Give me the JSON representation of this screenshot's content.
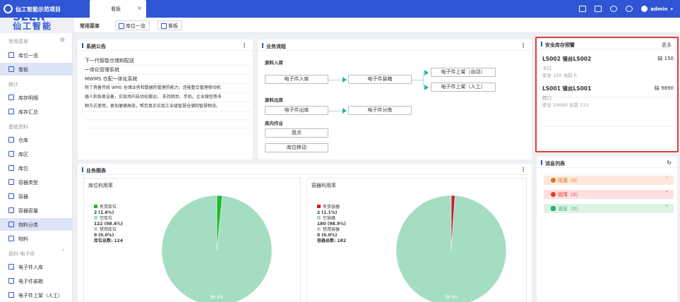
{
  "app": {
    "title": "仙工智能示范项目",
    "brand_text": "SEER",
    "brand_sub": "仙工智能"
  },
  "tabs": [
    {
      "label": "看板"
    }
  ],
  "user": {
    "name": "admin"
  },
  "quickbar": {
    "label": "常用菜单",
    "buttons": [
      {
        "label": "库位一览"
      },
      {
        "label": "看板"
      }
    ]
  },
  "sidebar": {
    "groups": [
      {
        "label": "常用菜单"
      },
      {
        "label": "统计"
      },
      {
        "label": "基础资料"
      },
      {
        "label": "原料-电子件"
      }
    ],
    "items": [
      {
        "label": "库位一览"
      },
      {
        "label": "看板"
      },
      {
        "label": "库存明细"
      },
      {
        "label": "库存汇总"
      },
      {
        "label": "仓库"
      },
      {
        "label": "库区"
      },
      {
        "label": "库位"
      },
      {
        "label": "容器类型"
      },
      {
        "label": "容器"
      },
      {
        "label": "容器容量"
      },
      {
        "label": "物料分类"
      },
      {
        "label": "物料"
      },
      {
        "label": "电子件入库"
      },
      {
        "label": "电子件装箱"
      },
      {
        "label": "电子件上架（人工）"
      }
    ]
  },
  "notice": {
    "title": "系统公告",
    "lines": [
      "下一代智能仓储和配送",
      "一体化管理系统",
      "MWMS 仓配一体化系统",
      "除了具备传统 WMS 仓储业务和数据的管理的能力，还能整合管理移动机",
      "器人和各类设备，实现场内自动化搬运。 支持网页、手机。企业微信等多",
      "种方式使用，更加便捷高效，帮您真正实现工业级智慧仓储和智慧物流。"
    ]
  },
  "flow": {
    "title": "业务流程",
    "sections": [
      {
        "label": "原料入库"
      },
      {
        "label": "原料出库"
      },
      {
        "label": "库内作业"
      }
    ],
    "boxes": [
      {
        "label": "电子件入库"
      },
      {
        "label": "电子件装箱"
      },
      {
        "label": "电子件上架（自动）"
      },
      {
        "label": "电子件上架（人工）"
      },
      {
        "label": "电子件出库"
      },
      {
        "label": "电子件分拣"
      },
      {
        "label": "盘点"
      },
      {
        "label": "库位移动"
      }
    ]
  },
  "safety": {
    "title": "安全库存预警",
    "more": "更多",
    "cards": [
      {
        "code": "LS002  镍丝LS002",
        "qty": "缺 150",
        "type": "卡口",
        "stat": "安全 150   当前 0"
      },
      {
        "code": "LS001  镍丝LS001",
        "qty": "缺 9890",
        "type": "銲口",
        "stat": "安全 10000   当前 110"
      }
    ]
  },
  "messages": {
    "title": "消息列表",
    "rows": [
      {
        "label": "阻塞（0）",
        "color": "#e8711f",
        "bg": "#fde9dc"
      },
      {
        "label": "故障（0）",
        "color": "#e53935",
        "bg": "#fde0df"
      },
      {
        "label": "消息（0）",
        "color": "#2fae6e",
        "bg": "#dcf3e6"
      }
    ]
  },
  "charts_panel": {
    "title": "业务图表"
  },
  "chart_data": [
    {
      "type": "pie",
      "title": "库位利用率",
      "legend": [
        {
          "label": "有货库位",
          "value": "2 (1.6%)",
          "color": "#20b830"
        },
        {
          "label": "空库位",
          "value": "122 (98.4%)",
          "color": "#a5ddc3"
        },
        {
          "label": "禁用库位",
          "value": "0 (0.0%)",
          "color": "#cccccc"
        }
      ],
      "values": [
        2,
        122,
        0
      ],
      "total_label": "库位总数: 124",
      "slice_label": "98.4%"
    },
    {
      "type": "pie",
      "title": "容器利用率",
      "legend": [
        {
          "label": "有货容器",
          "value": "2 (1.1%)",
          "color": "#c8202c"
        },
        {
          "label": "空容器",
          "value": "180 (98.9%)",
          "color": "#a5ddc3"
        },
        {
          "label": "禁用容器",
          "value": "0 (0.0%)",
          "color": "#cccccc"
        }
      ],
      "values": [
        2,
        180,
        0
      ],
      "total_label": "容器总数: 182",
      "slice_label": "98.9%"
    }
  ]
}
